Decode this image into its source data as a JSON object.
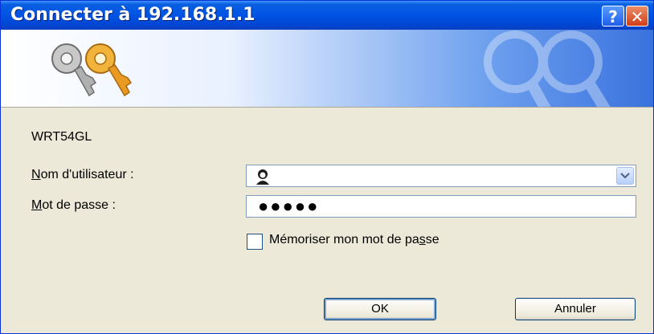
{
  "window": {
    "title": "Connecter à 192.168.1.1"
  },
  "titlebar": {
    "help_label": "?",
    "close_label": "✕"
  },
  "banner": {
    "icon": "keys-icon"
  },
  "realm": "WRT54GL",
  "form": {
    "username_label_accel": "N",
    "username_label_rest": "om d'utilisateur :",
    "username_icon": "user-icon",
    "password_label_accel": "M",
    "password_label_rest": "ot de passe :",
    "password_value": "●●●●●",
    "remember_before": "Mémoriser mon mot de pa",
    "remember_accel": "s",
    "remember_after": "se",
    "remember_checked": false
  },
  "buttons": {
    "ok": "OK",
    "cancel": "Annuler"
  },
  "colors": {
    "title_bar": "#0055e5",
    "close_button": "#cf3d18",
    "dialog_bg": "#ece9d8"
  }
}
